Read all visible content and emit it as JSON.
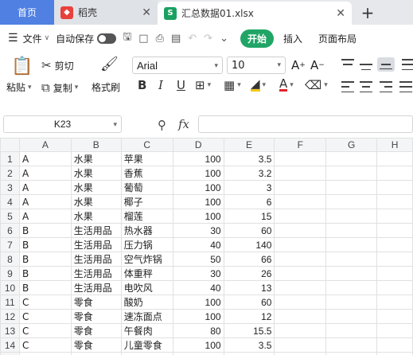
{
  "tabs": {
    "home": "首页",
    "wps": "稻壳",
    "file": "汇总数据01.xlsx",
    "add": "+"
  },
  "menu": {
    "file": "文件",
    "autosave": "自动保存",
    "start": "开始",
    "insert": "插入",
    "layout": "页面布局"
  },
  "ribbon": {
    "paste": "粘贴",
    "cut": "剪切",
    "copy": "复制",
    "format_painter": "格式刷",
    "font": "Arial",
    "font_size": "10"
  },
  "formula_bar": {
    "cell_ref": "K23",
    "fx": "fx",
    "value": ""
  },
  "sheet": {
    "columns": [
      "A",
      "B",
      "C",
      "D",
      "E",
      "F",
      "G",
      "H"
    ],
    "rows": [
      [
        "A",
        "水果",
        "苹果",
        "100",
        "3.5"
      ],
      [
        "A",
        "水果",
        "香蕉",
        "100",
        "3.2"
      ],
      [
        "A",
        "水果",
        "葡萄",
        "100",
        "3"
      ],
      [
        "A",
        "水果",
        "椰子",
        "100",
        "6"
      ],
      [
        "A",
        "水果",
        "榴莲",
        "100",
        "15"
      ],
      [
        "B",
        "生活用品",
        "热水器",
        "30",
        "60"
      ],
      [
        "B",
        "生活用品",
        "压力锅",
        "40",
        "140"
      ],
      [
        "B",
        "生活用品",
        "空气炸锅",
        "50",
        "66"
      ],
      [
        "B",
        "生活用品",
        "体重秤",
        "30",
        "26"
      ],
      [
        "B",
        "生活用品",
        "电吹风",
        "40",
        "13"
      ],
      [
        "C",
        "零食",
        "酸奶",
        "100",
        "60"
      ],
      [
        "C",
        "零食",
        "速冻面点",
        "100",
        "12"
      ],
      [
        "C",
        "零食",
        "午餐肉",
        "80",
        "15.5"
      ],
      [
        "C",
        "零食",
        "儿童零食",
        "100",
        "3.5"
      ],
      [
        "",
        "",
        "",
        "",
        ""
      ]
    ]
  },
  "colors": {
    "home_tab": "#4f80e2",
    "start_button": "#20a566",
    "highlight_color": "#f2c811",
    "font_color": "#e3242b"
  }
}
